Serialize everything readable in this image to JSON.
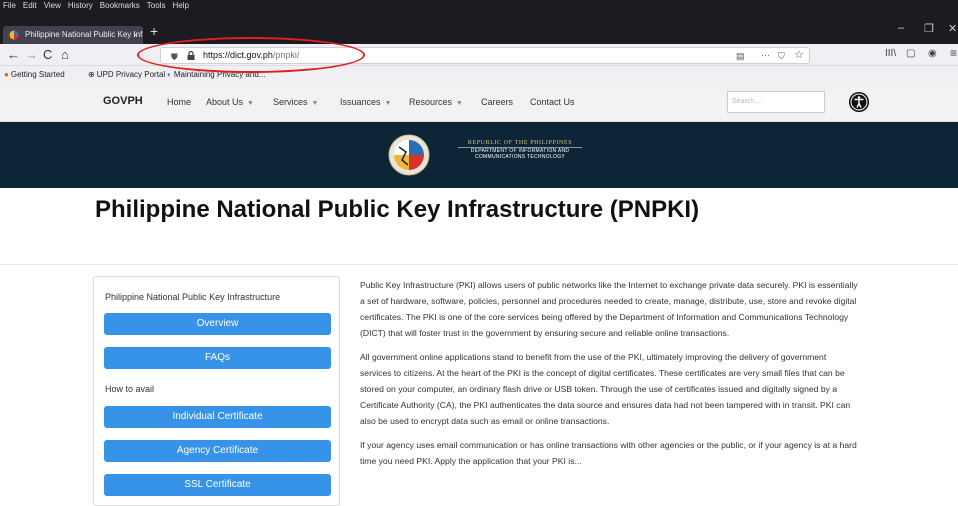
{
  "menubar": [
    "File",
    "Edit",
    "View",
    "History",
    "Bookmarks",
    "Tools",
    "Help"
  ],
  "tab": {
    "title": "Philippine National Public Key Infr...",
    "close": "×",
    "new": "+"
  },
  "window": {
    "minimize": "–",
    "restore": "❐",
    "close": "✕"
  },
  "nav": {
    "back": "←",
    "forward": "→",
    "reload": "C",
    "home": "⌂"
  },
  "url": {
    "domain": "https://dict.gov.ph",
    "path": "/pnpki/"
  },
  "toolbar": {
    "reader": "▤",
    "more": "···",
    "pocket": "⛉",
    "star": "☆",
    "library": "III\\",
    "sidebar": "▢",
    "account": "◉",
    "menu": "≡"
  },
  "bookmarks": [
    {
      "icon": "firefox-icon",
      "label": "Getting Started"
    },
    {
      "icon": "globe-icon",
      "label": "UPD Privacy Portal"
    },
    {
      "icon": "edge-icon",
      "label": "Maintaining Privacy and..."
    }
  ],
  "sitenav": {
    "brand": "GOVPH",
    "links": [
      "Home",
      "About Us",
      "Services",
      "Issuances",
      "Resources",
      "Careers",
      "Contact Us"
    ],
    "search_placeholder": "Search ..."
  },
  "banner": {
    "line1": "REPUBLIC OF THE PHILIPPINES",
    "line2": "DEPARTMENT OF INFORMATION AND",
    "line3": "COMMUNICATIONS TECHNOLOGY"
  },
  "page_title": "Philippine National Public Key Infrastructure (PNPKI)",
  "sidebar": {
    "title": "Philippine National Public Key Infrastructure",
    "how": "How to avail",
    "buttons": [
      "Overview",
      "FAQs",
      "Individual Certificate",
      "Agency Certificate",
      "SSL Certificate"
    ]
  },
  "paragraphs": [
    "Public Key Infrastructure (PKI) allows users of public networks like the Internet to exchange private data securely. PKI is essentially a set of hardware, software, policies, personnel and procedures needed to create, manage, distribute, use, store and revoke digital certificates. The PKI is one of the core services being offered by the Department of Information and Communications Technology (DICT) that will foster trust in the government by ensuring secure and reliable online transactions.",
    "All government online applications stand to benefit from the use of the PKI, ultimately improving the delivery of government services to citizens. At the heart of the PKI is the concept of digital certificates. These certificates are very small files that can be stored on your computer, an ordinary flash drive or USB token. Through the use of certificates issued and digitally signed by a Certificate Authority (CA), the PKI authenticates the data source and ensures data had not been tampered with in transit. PKI can also be used to encrypt data such as email or online transactions.",
    "If your agency uses email communication or has online transactions with other agencies or the public,  or if your agency is at a hard time you need PKI. Apply the application that your PKI is..."
  ]
}
